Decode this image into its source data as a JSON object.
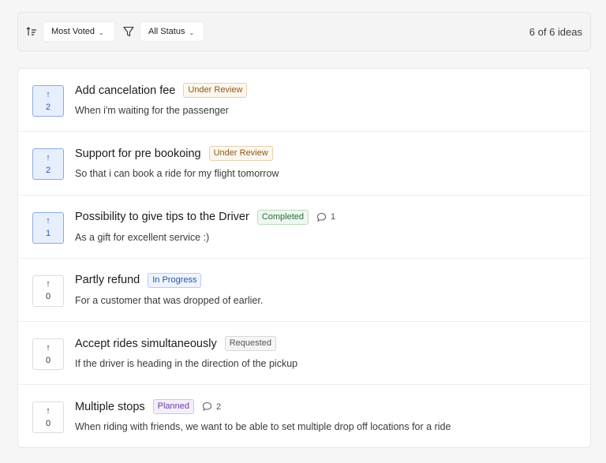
{
  "toolbar": {
    "sort_label": "Most Voted",
    "status_label": "All Status",
    "count_text": "6 of 6 ideas"
  },
  "colors": {
    "voted_bg": "#e7eefc",
    "voted_border": "#8fabe3",
    "voted_text": "#2958c4"
  },
  "ideas": [
    {
      "title": "Add cancelation fee",
      "status": "Under Review",
      "status_type": "review",
      "description": "When i'm waiting for the passenger",
      "votes": "2",
      "voted": true,
      "comments": null
    },
    {
      "title": "Support for pre bookoing",
      "status": "Under Review",
      "status_type": "review",
      "description": "So that i can book a ride for my flight tomorrow",
      "votes": "2",
      "voted": true,
      "comments": null
    },
    {
      "title": "Possibility to give tips to the Driver",
      "status": "Completed",
      "status_type": "completed",
      "description": "As a gift for excellent service :)",
      "votes": "1",
      "voted": true,
      "comments": "1"
    },
    {
      "title": "Partly refund",
      "status": "In Progress",
      "status_type": "progress",
      "description": "For a customer that was dropped of earlier.",
      "votes": "0",
      "voted": false,
      "comments": null
    },
    {
      "title": "Accept rides simultaneously",
      "status": "Requested",
      "status_type": "requested",
      "description": "If the driver is heading in the direction of the pickup",
      "votes": "0",
      "voted": false,
      "comments": null
    },
    {
      "title": "Multiple stops",
      "status": "Planned",
      "status_type": "planned",
      "description": "When riding with friends, we want to be able to set multiple drop off locations for a ride",
      "votes": "0",
      "voted": false,
      "comments": "2"
    }
  ]
}
